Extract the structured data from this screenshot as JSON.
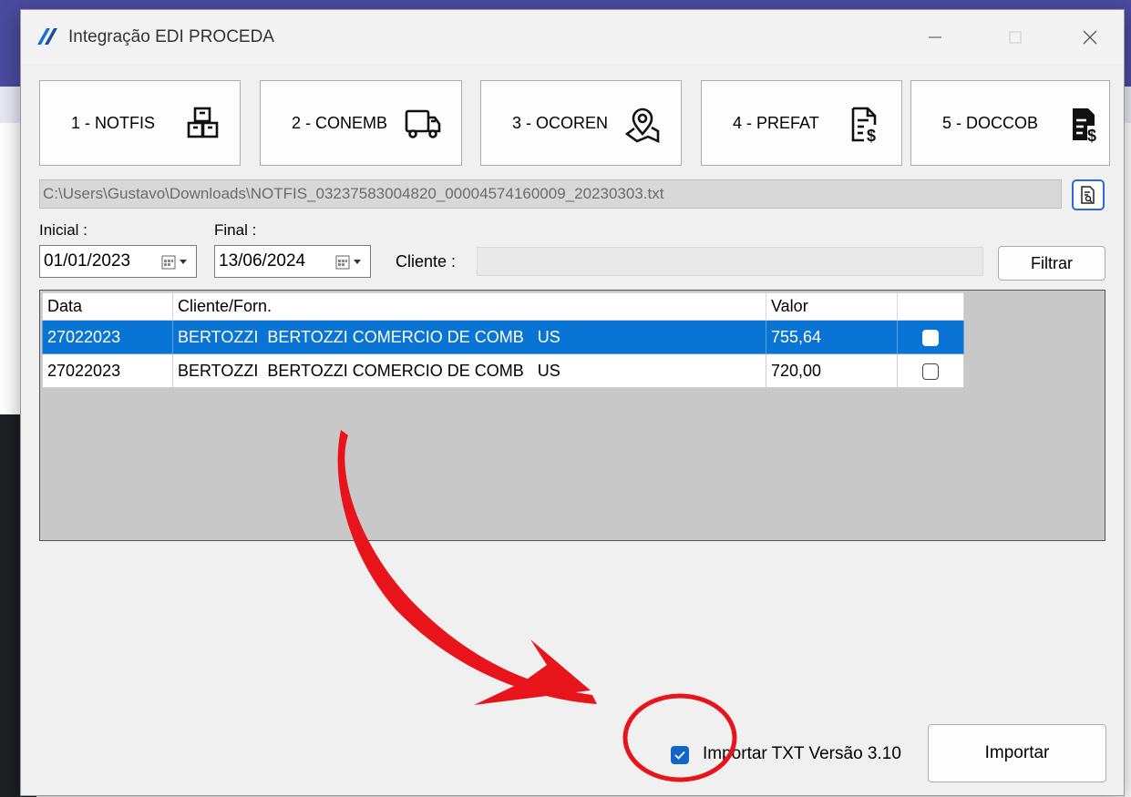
{
  "window": {
    "title": "Integração EDI PROCEDA"
  },
  "tabs": [
    {
      "label": "1 - NOTFIS",
      "icon": "boxes-icon"
    },
    {
      "label": "2 - CONEMB",
      "icon": "truck-icon"
    },
    {
      "label": "3 - OCOREN",
      "icon": "map-pin-icon"
    },
    {
      "label": "4 - PREFAT",
      "icon": "document-money-icon"
    },
    {
      "label": "5 - DOCCOB",
      "icon": "document-money-filled-icon"
    }
  ],
  "file_path": "C:\\Users\\Gustavo\\Downloads\\NOTFIS_03237583004820_00004574160009_20230303.txt",
  "filters": {
    "inicial_label": "Inicial :",
    "inicial_value": "01/01/2023",
    "final_label": "Final :",
    "final_value": "13/06/2024",
    "cliente_label": "Cliente :",
    "cliente_value": "",
    "filter_button": "Filtrar"
  },
  "grid": {
    "columns": [
      "Data",
      "Cliente/Forn.",
      "Valor",
      ""
    ],
    "rows": [
      {
        "data": "27022023",
        "cliente": "BERTOZZI  BERTOZZI COMERCIO DE COMB   US",
        "valor": "755,64",
        "checked": false,
        "selected": true
      },
      {
        "data": "27022023",
        "cliente": "BERTOZZI  BERTOZZI COMERCIO DE COMB   US",
        "valor": "720,00",
        "checked": false,
        "selected": false
      }
    ]
  },
  "footer": {
    "import_version_label": "Importar TXT Versão 3.10",
    "import_version_checked": true,
    "import_button": "Importar"
  },
  "colors": {
    "selection": "#0a74d4",
    "accent": "#1266c8",
    "annotation": "#e8141c"
  }
}
